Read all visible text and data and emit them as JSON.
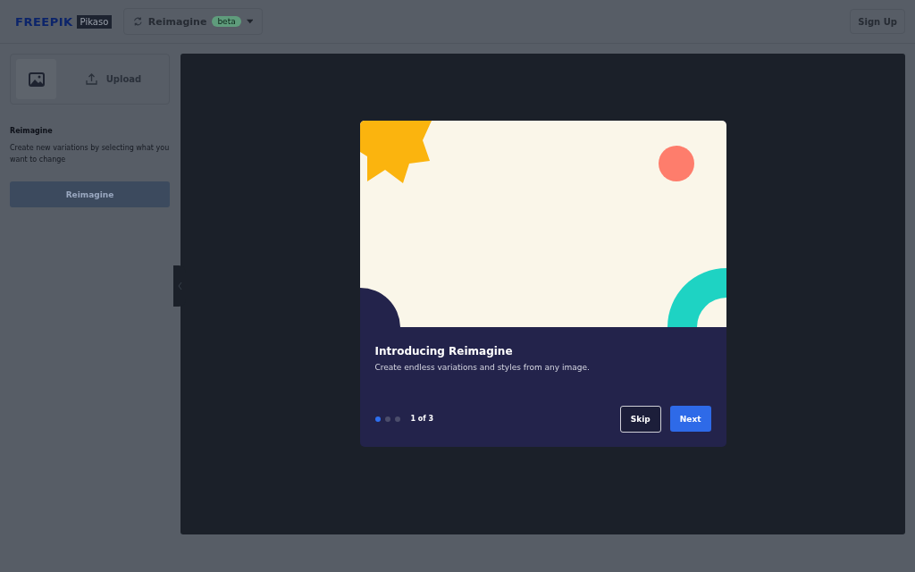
{
  "header": {
    "logo": "FREEPIK",
    "logo_badge": "Pikaso",
    "tool_selector": {
      "label": "Reimagine",
      "badge": "beta"
    },
    "sign_up": "Sign Up"
  },
  "sidebar": {
    "upload": "Upload",
    "section_title": "Reimagine",
    "section_text": "Create new variations by selecting what you want to change",
    "action_button": {
      "label": "Reimagine",
      "disabled": true
    }
  },
  "modal": {
    "title": "Introducing Reimagine",
    "text": "Create endless variations and styles from any image.",
    "dots": [
      {
        "selected": true
      },
      {
        "selected": false
      },
      {
        "selected": false
      }
    ],
    "counter": "1 of 3",
    "buttons": [
      "Skip",
      "Next"
    ]
  }
}
